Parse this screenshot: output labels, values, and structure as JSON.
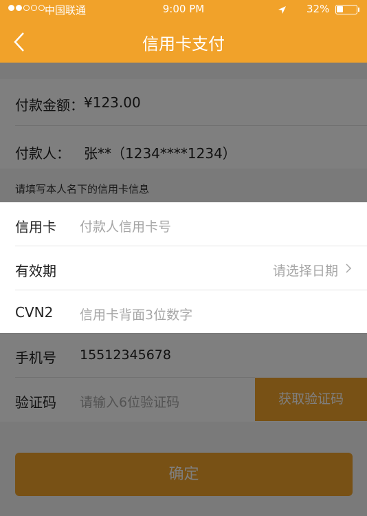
{
  "status_bar": {
    "carrier": "中国联通",
    "time": "9:00 PM",
    "battery": "32%",
    "battery_level": 0.32
  },
  "nav": {
    "title": "信用卡支付"
  },
  "payment": {
    "amount_label": "付款金额：",
    "amount_value": "¥123.00",
    "payer_label": "付款人：",
    "payer_value": "张**（1234****1234）"
  },
  "hint": "请填写本人名下的信用卡信息",
  "card_form": {
    "card_label": "信用卡",
    "card_placeholder": "付款人信用卡号",
    "expiry_label": "有效期",
    "expiry_placeholder": "请选择日期",
    "cvn_label": "CVN2",
    "cvn_placeholder": "信用卡背面3位数字"
  },
  "phone": {
    "label": "手机号",
    "value": "15512345678"
  },
  "verify": {
    "label": "验证码",
    "placeholder": "请输入6位验证码",
    "button": "获取验证码"
  },
  "confirm_button": "确定",
  "colors": {
    "accent": "#f1a22a"
  }
}
